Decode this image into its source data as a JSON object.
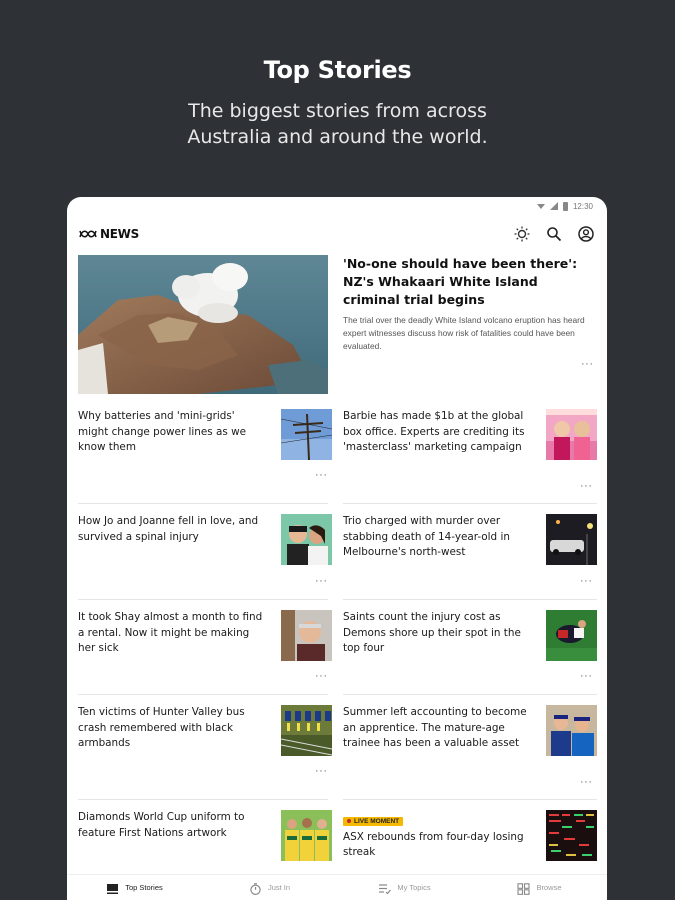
{
  "promo": {
    "title": "Top Stories",
    "subtitle_line1": "The biggest stories from across",
    "subtitle_line2": "Australia and around the world."
  },
  "status_bar": {
    "time": "12:30"
  },
  "app_bar": {
    "logo_text": "NEWS",
    "icons": [
      "theme-icon",
      "search-icon",
      "account-icon"
    ]
  },
  "hero": {
    "headline": "'No-one should have been there': NZ's Whakaari White Island criminal trial begins",
    "summary": "The trial over the deadly White Island volcano eruption has heard expert witnesses discuss how risk of fatalities could have been evaluated.",
    "more": "···"
  },
  "stories": [
    {
      "title": "Why batteries and 'mini-grids' might change power lines as we know them",
      "more": "···"
    },
    {
      "title": "Barbie has made $1b at the global box office. Experts are crediting its 'masterclass' marketing campaign",
      "more": "···"
    },
    {
      "title": "How Jo and Joanne fell in love, and survived a spinal injury",
      "more": "···"
    },
    {
      "title": "Trio charged with murder over stabbing death of 14-year-old in Melbourne's north-west",
      "more": "···"
    },
    {
      "title": "It took Shay almost a month to find a rental. Now it might be making her sick",
      "more": "···"
    },
    {
      "title": "Saints count the injury cost as Demons shore up their spot in the top four",
      "more": "···"
    },
    {
      "title": "Ten victims of Hunter Valley bus crash remembered with black armbands",
      "more": "···"
    },
    {
      "title": "Summer left accounting to become an apprentice. The mature-age trainee has been a valuable asset",
      "more": "···"
    },
    {
      "title": "Diamonds World Cup uniform to feature First Nations artwork",
      "more": "···"
    },
    {
      "badge": "LIVE MOMENT",
      "title": "ASX rebounds from four-day losing streak",
      "more": "···"
    }
  ],
  "bottom_nav": [
    {
      "label": "Top Stories",
      "icon": "top-stories-icon",
      "active": true
    },
    {
      "label": "Just In",
      "icon": "stopwatch-icon",
      "active": false
    },
    {
      "label": "My Topics",
      "icon": "my-topics-icon",
      "active": false
    },
    {
      "label": "Browse",
      "icon": "grid-icon",
      "active": false
    }
  ],
  "colors": {
    "background": "#2e3136",
    "live_badge": "#f5b800"
  }
}
